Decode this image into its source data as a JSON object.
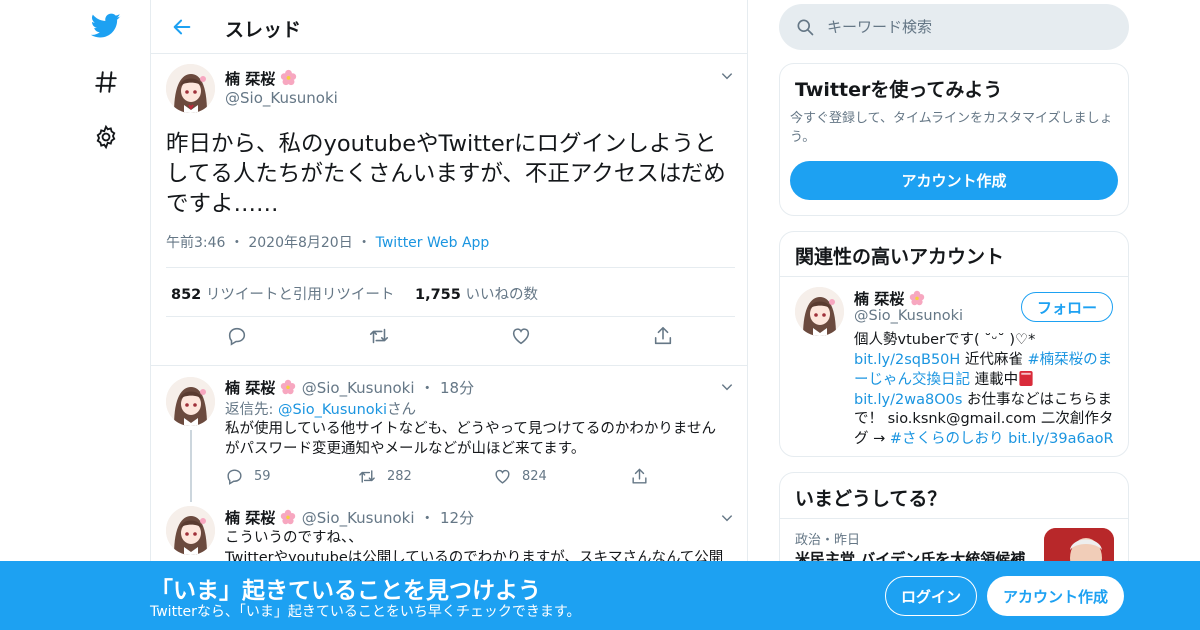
{
  "nav": {
    "icons": [
      "twitter-logo-icon",
      "hashtag-icon",
      "gear-icon"
    ]
  },
  "header": {
    "title": "スレッド"
  },
  "user": {
    "name": "楠 栞桜",
    "handle": "@Sio_Kusunoki"
  },
  "main_tweet": {
    "text": "昨日から、私のyoutubeやTwitterにログインしようとしてる人たちがたくさんいますが、不正アクセスはだめですよ……",
    "time": "午前3:46",
    "date": "2020年8月20日",
    "source": "Twitter Web App",
    "retweets_count": "852",
    "retweets_label": "リツイートと引用リツイート",
    "likes_count": "1,755",
    "likes_label": "いいねの数"
  },
  "replies": [
    {
      "name": "楠 栞桜",
      "handle": "@Sio_Kusunoki",
      "time": "18分",
      "reply_prefix": "返信先: ",
      "reply_to": "@Sio_Kusunoki",
      "reply_suffix": "さん",
      "text": "私が使用している他サイトなども、どうやって見つけてるのかわかりませんがパスワード変更通知やメールなどが山ほど来てます。",
      "replies_count": "59",
      "retweets_count": "282",
      "likes_count": "824"
    },
    {
      "name": "楠 栞桜",
      "handle": "@Sio_Kusunoki",
      "time": "12分",
      "text_line1": "こういうのですね、、",
      "text_line2": "Twitterやyoutubeは公開しているのでわかりますが、スキマさんなんて公開"
    }
  ],
  "search": {
    "placeholder": "キーワード検索"
  },
  "signup_card": {
    "title": "Twitterを使ってみよう",
    "description": "今すぐ登録して、タイムラインをカスタマイズしましょう。",
    "button": "アカウント作成"
  },
  "related_card": {
    "title": "関連性の高いアカウント",
    "name": "楠 栞桜",
    "handle": "@Sio_Kusunoki",
    "follow_button": "フォロー",
    "bio_line1": "個人勢vtuberです( ˘ᵕ˘ )♡*",
    "bio_link1": "bit.ly/2sqB50H",
    "bio_text1": " 近代麻雀 ",
    "bio_hashtag1a": "#楠栞桜のま",
    "bio_hashtag1b": "ーじゃん交換日記",
    "bio_text2": " 連載中",
    "bio_link2": "bit.ly/2wa8O0s",
    "bio_text3": " お仕事などはこちらま",
    "bio_text4": "で！ sio.ksnk@gmail.com 二次創作タ",
    "bio_text5": "グ → ",
    "bio_hashtag2": "#さくらのしおり",
    "bio_link3": "bit.ly/39a6aoR"
  },
  "trends_card": {
    "title": "いまどうしてる？",
    "meta": "政治・昨日",
    "headline": "米民主党 バイデン氏を大統領候補"
  },
  "banner": {
    "title": "「いま」起きていることを見つけよう",
    "subtitle": "Twitterなら、「いま」起きていることをいち早くチェックできます。",
    "login": "ログイン",
    "signup": "アカウント作成"
  },
  "colors": {
    "accent": "#1da1f2",
    "link": "#1b95e0",
    "muted": "#657786",
    "border": "#e6ecf0"
  }
}
